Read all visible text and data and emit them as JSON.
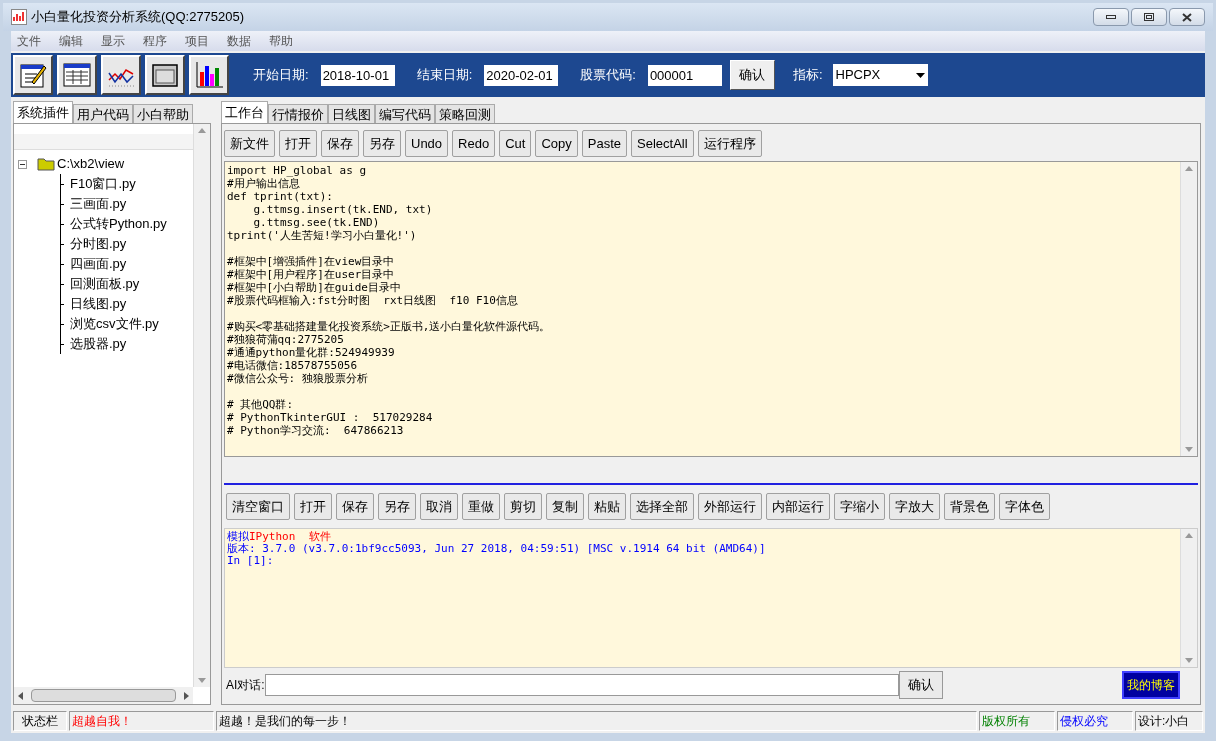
{
  "window": {
    "title": "小白量化投资分析系统(QQ:2775205)"
  },
  "menu": [
    "文件",
    "编辑",
    "显示",
    "程序",
    "项目",
    "数据",
    "帮助"
  ],
  "toolbar": {
    "fields": [
      {
        "label": "开始日期:",
        "value": "2018-10-01"
      },
      {
        "label": "结束日期:",
        "value": "2020-02-01"
      },
      {
        "label": "股票代码:",
        "value": "000001"
      }
    ],
    "confirm": "确认",
    "indicator": {
      "label": "指标:",
      "value": "HPCPX"
    }
  },
  "left_tabs": [
    {
      "label": "系统插件",
      "selected": true
    },
    {
      "label": "用户代码",
      "selected": false
    },
    {
      "label": "小白帮助",
      "selected": false
    }
  ],
  "tree": {
    "label": "C:\\xb2\\view",
    "expanded": true,
    "children": [
      {
        "label": "F10窗口.py"
      },
      {
        "label": "三画面.py"
      },
      {
        "label": "公式转Python.py"
      },
      {
        "label": "分时图.py"
      },
      {
        "label": "四画面.py"
      },
      {
        "label": "回测面板.py"
      },
      {
        "label": "日线图.py"
      },
      {
        "label": "浏览csv文件.py"
      },
      {
        "label": "选股器.py"
      }
    ]
  },
  "main_tabs": [
    {
      "label": "工作台",
      "selected": true
    },
    {
      "label": "行情报价",
      "selected": false
    },
    {
      "label": "日线图",
      "selected": false
    },
    {
      "label": "编写代码",
      "selected": false
    },
    {
      "label": "策略回测",
      "selected": false
    }
  ],
  "editor_buttons": [
    "新文件",
    "打开",
    "保存",
    "另存",
    "Undo",
    "Redo",
    "Cut",
    "Copy",
    "Paste",
    "SelectAll",
    "运行程序"
  ],
  "editor_blocks": [
    [
      "import HP_global as g",
      "#用户输出信息",
      "def tprint(txt):",
      "    g.ttmsg.insert(tk.END, txt)",
      "    g.ttmsg.see(tk.END)",
      "tprint('人生苦短!学习小白量化!')"
    ],
    [
      "#框架中[增强插件]在view目录中",
      "#框架中[用户程序]在user目录中",
      "#框架中[小白帮助]在guide目录中",
      "#股票代码框输入:fst分时图  rxt日线图  f10 F10信息"
    ],
    [
      "#购买<零基础搭建量化投资系统>正版书,送小白量化软件源代码。",
      "#独狼荷蒲qq:2775205",
      "#通通python量化群:524949939",
      "#电话微信:18578755056",
      "#微信公众号: 独狼股票分析"
    ],
    [
      "# 其他QQ群:",
      "# PythonTkinterGUI :  517029284",
      "# Python学习交流:  647866213"
    ]
  ],
  "console_buttons": [
    "清空窗口",
    "打开",
    "保存",
    "另存",
    "取消",
    "重做",
    "剪切",
    "复制",
    "粘贴",
    "选择全部",
    "外部运行",
    "内部运行",
    "字缩小",
    "字放大",
    "背景色",
    "字体色"
  ],
  "console_lines": [
    [
      {
        "text": "模拟",
        "kind": "info"
      },
      {
        "text": "IPython  软件",
        "kind": "alert"
      }
    ],
    [
      {
        "text": "版本: 3.7.0 (v3.7.0:1bf9cc5093, Jun 27 2018, 04:59:51) [MSC v.1914 64 bit (AMD64)]",
        "kind": "info"
      }
    ],
    [
      {
        "text": "In [1]:",
        "kind": "info"
      }
    ]
  ],
  "ai": {
    "label": "AI对话:",
    "confirm": "确认",
    "blog": "我的博客"
  },
  "status_bar": [
    {
      "text": "状态栏",
      "kind": "plain"
    },
    {
      "text": "超越自我！",
      "kind": "alert"
    },
    {
      "text": "超越！是我们的每一步！",
      "kind": "plain"
    },
    {
      "text": "版权所有",
      "kind": "ok"
    },
    {
      "text": "侵权必究",
      "kind": "info"
    },
    {
      "text": "设计:小白",
      "kind": "plain"
    }
  ]
}
